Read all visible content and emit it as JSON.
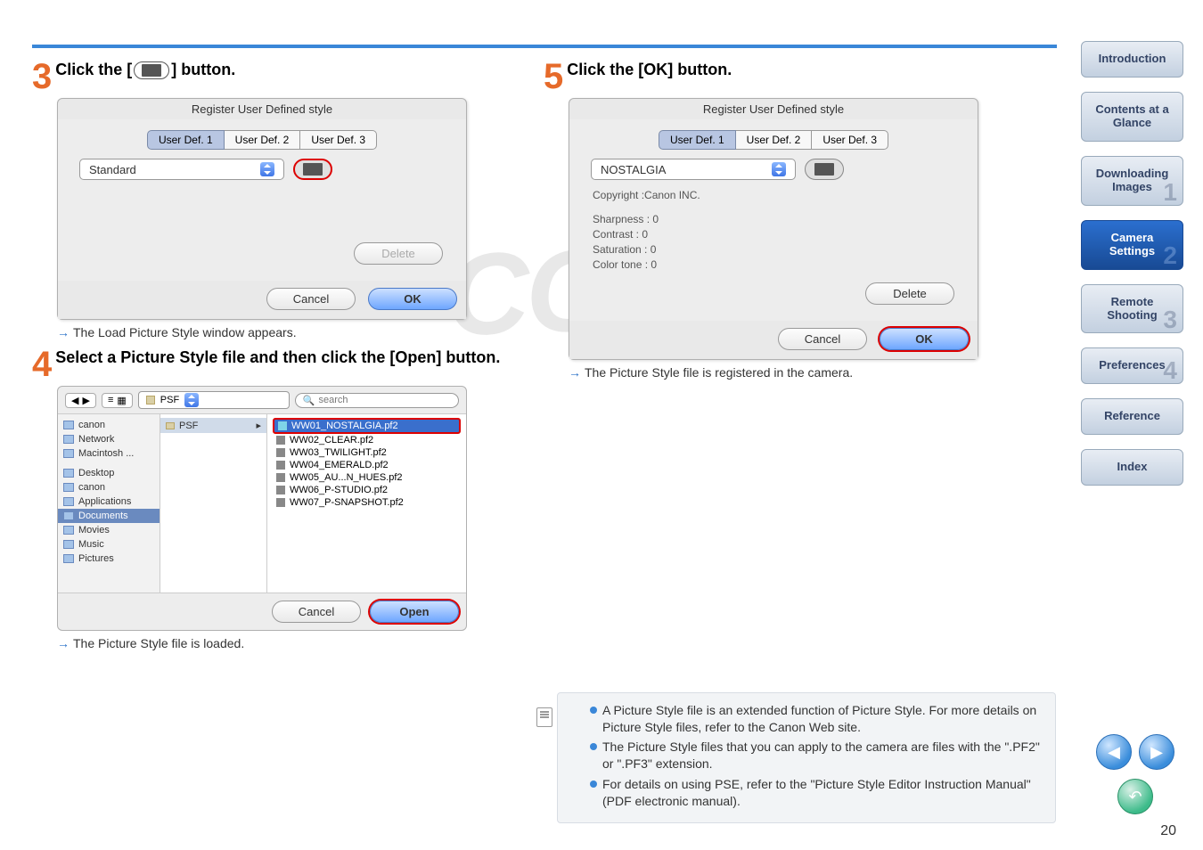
{
  "page_number": "20",
  "watermark": "COPY",
  "step3": {
    "num": "3",
    "heading_prefix": "Click the [",
    "heading_suffix": "] button.",
    "dialog_title": "Register User Defined style",
    "tabs": [
      "User Def. 1",
      "User Def. 2",
      "User Def. 3"
    ],
    "style": "Standard",
    "delete": "Delete",
    "cancel": "Cancel",
    "ok": "OK",
    "note": "The Load Picture Style window appears."
  },
  "step4": {
    "num": "4",
    "heading": "Select a Picture Style file and then click the [Open] button.",
    "psf_label": "PSF",
    "search_placeholder": "search",
    "sidebar": [
      "canon",
      "Network",
      "Macintosh ...",
      "Desktop",
      "canon",
      "Applications",
      "Documents",
      "Movies",
      "Music",
      "Pictures"
    ],
    "midcol": "PSF",
    "files": [
      "WW01_NOSTALGIA.pf2",
      "WW02_CLEAR.pf2",
      "WW03_TWILIGHT.pf2",
      "WW04_EMERALD.pf2",
      "WW05_AU...N_HUES.pf2",
      "WW06_P-STUDIO.pf2",
      "WW07_P-SNAPSHOT.pf2"
    ],
    "cancel": "Cancel",
    "open": "Open",
    "note": "The Picture Style file is loaded."
  },
  "step5": {
    "num": "5",
    "heading": "Click the [OK] button.",
    "dialog_title": "Register User Defined style",
    "tabs": [
      "User Def. 1",
      "User Def. 2",
      "User Def. 3"
    ],
    "style": "NOSTALGIA",
    "copyright": "Copyright :Canon INC.",
    "settings": [
      "Sharpness : 0",
      "Contrast : 0",
      "Saturation : 0",
      "Color tone : 0"
    ],
    "delete": "Delete",
    "cancel": "Cancel",
    "ok": "OK",
    "note": "The Picture Style file is registered in the camera."
  },
  "info": {
    "b1": "A Picture Style file is an extended function of Picture Style. For more details on Picture Style files, refer to the Canon Web site.",
    "b2": "The Picture Style files that you can apply to the camera are files with the \".PF2\" or \".PF3\" extension.",
    "b3": "For details on using PSE, refer to the \"Picture Style Editor Instruction Manual\" (PDF electronic manual)."
  },
  "nav": {
    "intro": "Introduction",
    "contents": "Contents at a Glance",
    "download": "Downloading Images",
    "camera": "Camera Settings",
    "remote": "Remote Shooting",
    "prefs": "Preferences",
    "reference": "Reference",
    "index": "Index",
    "watermarks": {
      "download": "1",
      "camera": "2",
      "remote": "3",
      "prefs": "4"
    }
  }
}
